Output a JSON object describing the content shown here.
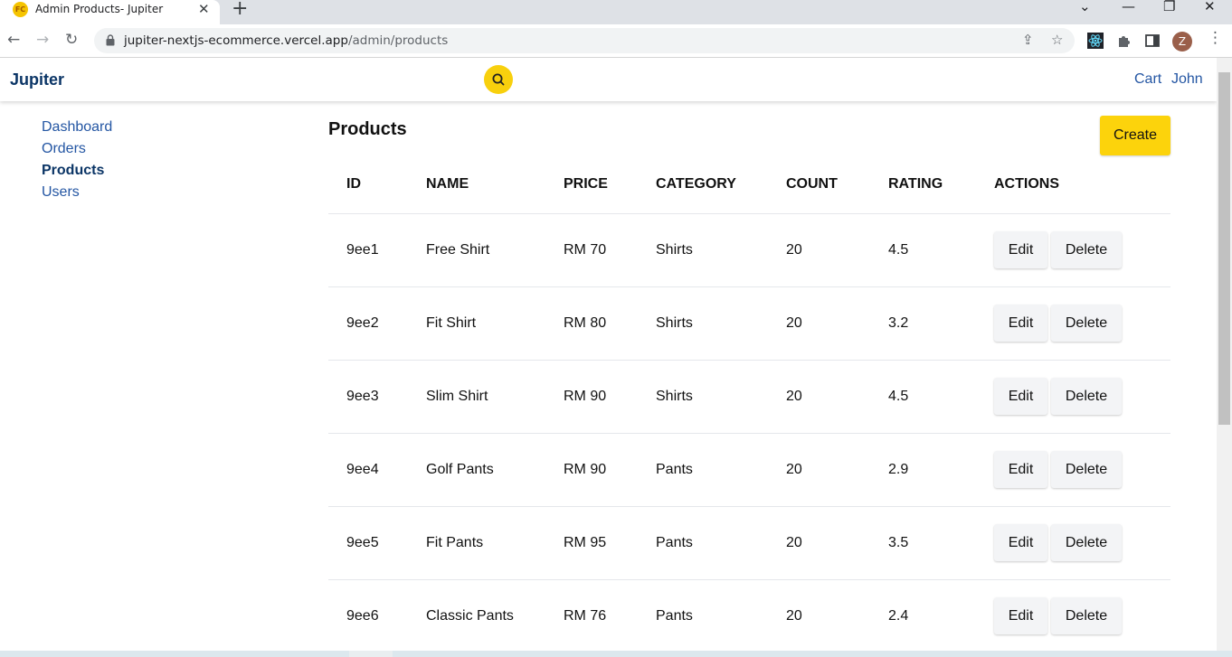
{
  "browser": {
    "tab_title": "Admin Products- Jupiter",
    "favicon_text": "FC",
    "url_host": "jupiter-nextjs-ecommerce.vercel.app",
    "url_path": "/admin/products",
    "profile_initial": "Z"
  },
  "header": {
    "brand": "Jupiter",
    "cart_label": "Cart",
    "user_label": "John"
  },
  "sidebar": {
    "items": [
      {
        "label": "Dashboard",
        "active": false
      },
      {
        "label": "Orders",
        "active": false
      },
      {
        "label": "Products",
        "active": true
      },
      {
        "label": "Users",
        "active": false
      }
    ]
  },
  "main": {
    "title": "Products",
    "create_label": "Create",
    "columns": [
      "ID",
      "NAME",
      "PRICE",
      "CATEGORY",
      "COUNT",
      "RATING",
      "ACTIONS"
    ],
    "edit_label": "Edit",
    "delete_label": "Delete",
    "rows": [
      {
        "id": "9ee1",
        "name": "Free Shirt",
        "price": "RM 70",
        "category": "Shirts",
        "count": "20",
        "rating": "4.5"
      },
      {
        "id": "9ee2",
        "name": "Fit Shirt",
        "price": "RM 80",
        "category": "Shirts",
        "count": "20",
        "rating": "3.2"
      },
      {
        "id": "9ee3",
        "name": "Slim Shirt",
        "price": "RM 90",
        "category": "Shirts",
        "count": "20",
        "rating": "4.5"
      },
      {
        "id": "9ee4",
        "name": "Golf Pants",
        "price": "RM 90",
        "category": "Pants",
        "count": "20",
        "rating": "2.9"
      },
      {
        "id": "9ee5",
        "name": "Fit Pants",
        "price": "RM 95",
        "category": "Pants",
        "count": "20",
        "rating": "3.5"
      },
      {
        "id": "9ee6",
        "name": "Classic Pants",
        "price": "RM 76",
        "category": "Pants",
        "count": "20",
        "rating": "2.4"
      }
    ]
  },
  "colors": {
    "brand": "#0b3566",
    "link": "#2456a3",
    "accent_yellow": "#fcd30c",
    "action_button_bg": "#f3f4f6"
  }
}
